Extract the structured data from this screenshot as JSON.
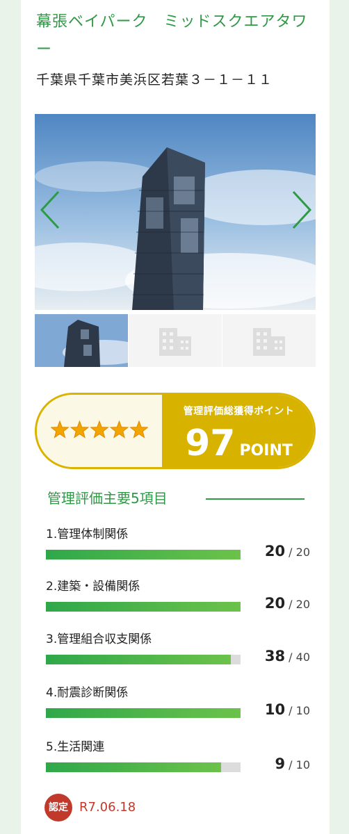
{
  "property": {
    "name": "幕張ベイパーク　ミッドスクエアタワー",
    "address": "千葉県千葉市美浜区若葉３－１－１１"
  },
  "gallery": {
    "prev_icon": "chevron-left-icon",
    "next_icon": "chevron-right-icon",
    "thumbnails": [
      "building-photo",
      "building-placeholder-icon",
      "building-placeholder-icon"
    ]
  },
  "points": {
    "stars": 5,
    "label": "管理評価総獲得ポイント",
    "value": "97",
    "unit": "POINT",
    "accent": "#d7b300"
  },
  "evaluation": {
    "title": "管理評価主要5項目",
    "items": [
      {
        "label": "1.管理体制関係",
        "score": "20",
        "max": "/ 20",
        "fill": 1.0
      },
      {
        "label": "2.建築・設備関係",
        "score": "20",
        "max": "/ 20",
        "fill": 1.0
      },
      {
        "label": "3.管理組合収支関係",
        "score": "38",
        "max": "/ 40",
        "fill": 0.95
      },
      {
        "label": "4.耐震診断関係",
        "score": "10",
        "max": "/ 10",
        "fill": 1.0
      },
      {
        "label": "5.生活関連",
        "score": "9",
        "max": "/ 10",
        "fill": 0.9
      }
    ]
  },
  "certification": {
    "badge": "認定",
    "date": "R7.06.18",
    "color": "#c0392b"
  }
}
